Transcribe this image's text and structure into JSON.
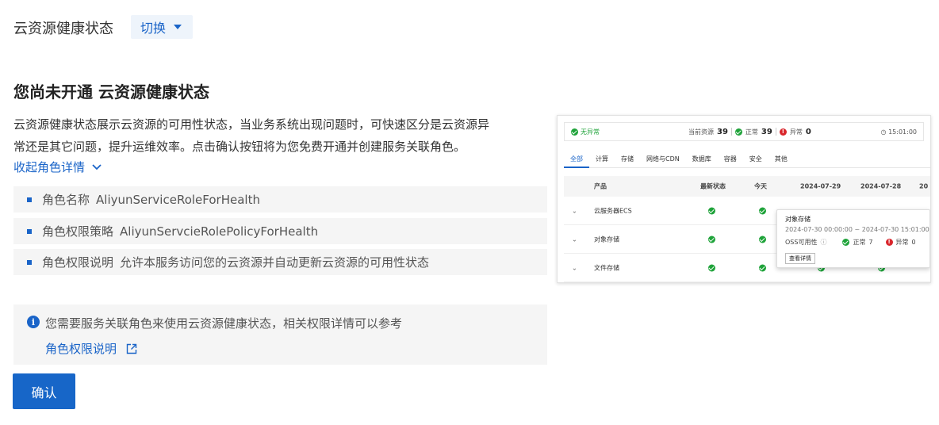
{
  "header": {
    "title": "云资源健康状态",
    "switch_label": "切换"
  },
  "main": {
    "title": "您尚未开通 云资源健康状态",
    "description_line1": "云资源健康状态展示云资源的可用性状态，当业务系统出现问题时，可快速区分是云资源异",
    "description_line2": "常还是其它问题，提升运维效率。点击确认按钮将为您免费开通并创建服务关联角色。",
    "collapse_label": "收起角色详情",
    "role_items": [
      {
        "key": "角色名称",
        "value": "AliyunServiceRoleForHealth"
      },
      {
        "key": "角色权限策略",
        "value": "AliyunServcieRolePolicyForHealth"
      },
      {
        "key": "角色权限说明",
        "value": "允许本服务访问您的云资源并自动更新云资源的可用性状态"
      }
    ],
    "notice": {
      "text": "您需要服务关联角色来使用云资源健康状态，相关权限详情可以参考",
      "link": "角色权限说明"
    },
    "confirm_label": "确认"
  },
  "preview": {
    "status": "无异常",
    "current_label": "当前资源",
    "current_count": "39",
    "normal_label": "正常",
    "normal_count": "39",
    "abnormal_label": "异常",
    "abnormal_count": "0",
    "time": "15:01:00",
    "tabs": [
      "全部",
      "计算",
      "存储",
      "网络与CDN",
      "数据库",
      "容器",
      "安全",
      "其他"
    ],
    "columns": [
      "产品",
      "最新状态",
      "今天",
      "2024-07-29",
      "2024-07-28",
      "20"
    ],
    "rows": [
      "云服务器ECS",
      "对象存储",
      "文件存储"
    ],
    "tooltip": {
      "title": "对象存储",
      "range": "2024-07-30 00:00:00 ~ 2024-07-30 15:01:00",
      "metric": "OSS可用性",
      "normal_label": "正常",
      "normal": "7",
      "abnormal_label": "异常",
      "abnormal": "0",
      "button": "查看详情"
    }
  }
}
